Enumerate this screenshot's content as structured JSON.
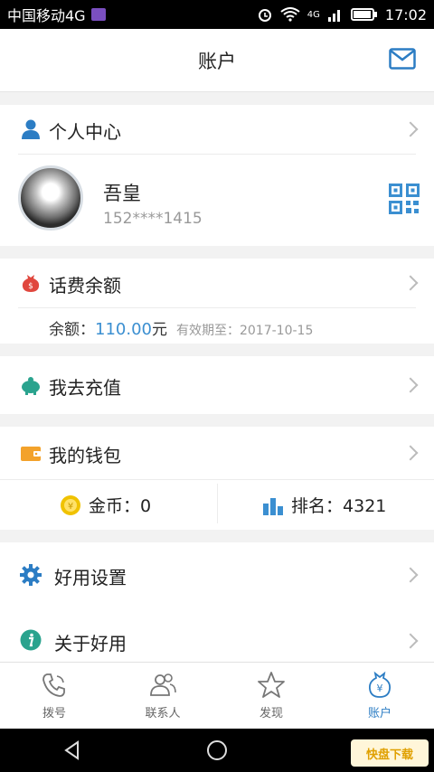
{
  "status_bar": {
    "carrier": "中国移动4G",
    "time": "17:02",
    "network": "4G"
  },
  "header": {
    "title": "账户",
    "mail_icon": "mail-icon"
  },
  "profile": {
    "section_label": "个人中心",
    "name": "吾皇",
    "phone": "152****1415",
    "qr_icon": "qr-code-icon"
  },
  "balance": {
    "section_label": "话费余额",
    "amount_label": "余额：",
    "amount_value": "110.00",
    "amount_unit": "元",
    "expiry_label": "有效期至：",
    "expiry_date": "2017-10-15"
  },
  "recharge": {
    "label": "我去充值"
  },
  "wallet": {
    "label": "我的钱包",
    "coins_label": "金币：",
    "coins_value": "0",
    "rank_label": "排名：",
    "rank_value": "4321"
  },
  "settings": {
    "label": "好用设置"
  },
  "about": {
    "label": "关于好用"
  },
  "tabs": [
    {
      "label": "拨号",
      "icon": "phone-icon"
    },
    {
      "label": "联系人",
      "icon": "contacts-icon"
    },
    {
      "label": "发现",
      "icon": "star-icon"
    },
    {
      "label": "账户",
      "icon": "money-bag-icon"
    }
  ],
  "watermark": {
    "text": "快盘下载"
  },
  "colors": {
    "accent": "#2c7dc4",
    "amount": "#3b8fd1",
    "red_icon": "#e0473e",
    "teal_icon": "#2aa38e",
    "wallet_icon": "#f3a22b",
    "coin_icon": "#f0c200"
  }
}
